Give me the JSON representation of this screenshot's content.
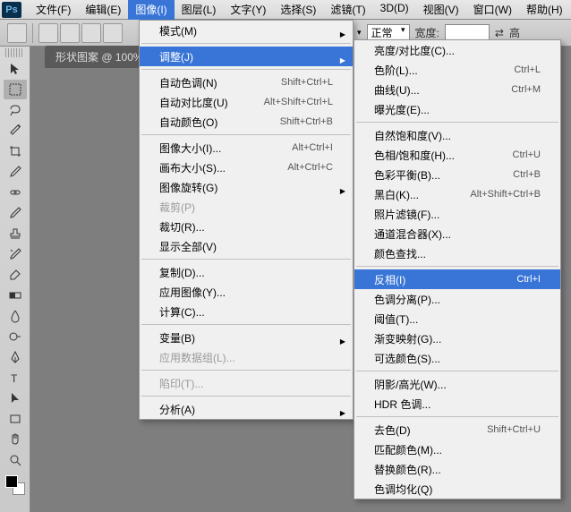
{
  "menubar": {
    "items": [
      "文件(F)",
      "编辑(E)",
      "图像(I)",
      "图层(L)",
      "文字(Y)",
      "选择(S)",
      "滤镜(T)",
      "3D(D)",
      "视图(V)",
      "窗口(W)",
      "帮助(H)"
    ],
    "activeIndex": 2,
    "logo": "Ps"
  },
  "optbar": {
    "mode_label": "正常",
    "width_label": "宽度:",
    "height_label": "高"
  },
  "doc": {
    "tab": "形状图案 @ 100%",
    "close": "×"
  },
  "menu1": {
    "rows": [
      {
        "t": "row",
        "label": "模式(M)",
        "sub": true
      },
      {
        "t": "sep"
      },
      {
        "t": "row",
        "label": "调整(J)",
        "sub": true,
        "hl": true
      },
      {
        "t": "sep"
      },
      {
        "t": "row",
        "label": "自动色调(N)",
        "sc": "Shift+Ctrl+L"
      },
      {
        "t": "row",
        "label": "自动对比度(U)",
        "sc": "Alt+Shift+Ctrl+L"
      },
      {
        "t": "row",
        "label": "自动颜色(O)",
        "sc": "Shift+Ctrl+B"
      },
      {
        "t": "sep"
      },
      {
        "t": "row",
        "label": "图像大小(I)...",
        "sc": "Alt+Ctrl+I"
      },
      {
        "t": "row",
        "label": "画布大小(S)...",
        "sc": "Alt+Ctrl+C"
      },
      {
        "t": "row",
        "label": "图像旋转(G)",
        "sub": true
      },
      {
        "t": "row",
        "label": "裁剪(P)",
        "disabled": true
      },
      {
        "t": "row",
        "label": "裁切(R)..."
      },
      {
        "t": "row",
        "label": "显示全部(V)"
      },
      {
        "t": "sep"
      },
      {
        "t": "row",
        "label": "复制(D)..."
      },
      {
        "t": "row",
        "label": "应用图像(Y)..."
      },
      {
        "t": "row",
        "label": "计算(C)..."
      },
      {
        "t": "sep"
      },
      {
        "t": "row",
        "label": "变量(B)",
        "sub": true
      },
      {
        "t": "row",
        "label": "应用数据组(L)...",
        "disabled": true
      },
      {
        "t": "sep"
      },
      {
        "t": "row",
        "label": "陷印(T)...",
        "disabled": true
      },
      {
        "t": "sep"
      },
      {
        "t": "row",
        "label": "分析(A)",
        "sub": true
      }
    ]
  },
  "menu2": {
    "rows": [
      {
        "t": "row",
        "label": "亮度/对比度(C)..."
      },
      {
        "t": "row",
        "label": "色阶(L)...",
        "sc": "Ctrl+L"
      },
      {
        "t": "row",
        "label": "曲线(U)...",
        "sc": "Ctrl+M"
      },
      {
        "t": "row",
        "label": "曝光度(E)..."
      },
      {
        "t": "sep"
      },
      {
        "t": "row",
        "label": "自然饱和度(V)..."
      },
      {
        "t": "row",
        "label": "色相/饱和度(H)...",
        "sc": "Ctrl+U"
      },
      {
        "t": "row",
        "label": "色彩平衡(B)...",
        "sc": "Ctrl+B"
      },
      {
        "t": "row",
        "label": "黑白(K)...",
        "sc": "Alt+Shift+Ctrl+B"
      },
      {
        "t": "row",
        "label": "照片滤镜(F)..."
      },
      {
        "t": "row",
        "label": "通道混合器(X)..."
      },
      {
        "t": "row",
        "label": "颜色查找..."
      },
      {
        "t": "sep"
      },
      {
        "t": "row",
        "label": "反相(I)",
        "sc": "Ctrl+I",
        "hl": true
      },
      {
        "t": "row",
        "label": "色调分离(P)..."
      },
      {
        "t": "row",
        "label": "阈值(T)..."
      },
      {
        "t": "row",
        "label": "渐变映射(G)..."
      },
      {
        "t": "row",
        "label": "可选颜色(S)..."
      },
      {
        "t": "sep"
      },
      {
        "t": "row",
        "label": "阴影/高光(W)..."
      },
      {
        "t": "row",
        "label": "HDR 色调..."
      },
      {
        "t": "sep"
      },
      {
        "t": "row",
        "label": "去色(D)",
        "sc": "Shift+Ctrl+U"
      },
      {
        "t": "row",
        "label": "匹配颜色(M)..."
      },
      {
        "t": "row",
        "label": "替换颜色(R)..."
      },
      {
        "t": "row",
        "label": "色调均化(Q)"
      }
    ]
  }
}
